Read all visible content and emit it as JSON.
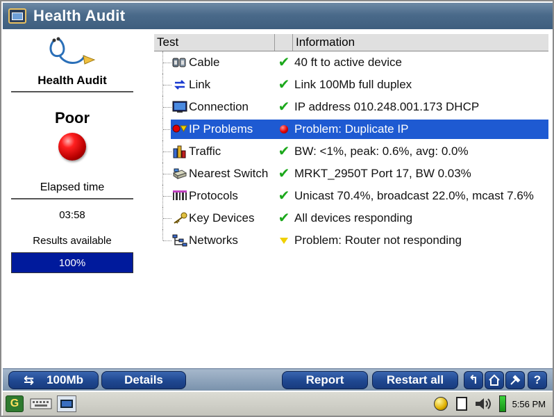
{
  "window": {
    "title": "Health Audit"
  },
  "left_panel": {
    "title": "Health Audit",
    "status": "Poor",
    "elapsed_label": "Elapsed time",
    "elapsed_value": "03:58",
    "results_label": "Results available",
    "progress_percent": 100,
    "progress_text": "100%"
  },
  "table": {
    "columns": [
      "Test",
      "",
      "Information"
    ],
    "rows": [
      {
        "test": "Cable",
        "icon": "cable-icon",
        "status": "ok",
        "info": "40 ft to active device"
      },
      {
        "test": "Link",
        "icon": "link-arrows-icon",
        "status": "ok",
        "info": "Link 100Mb full duplex"
      },
      {
        "test": "Connection",
        "icon": "monitor-icon",
        "status": "ok",
        "info": "IP address 010.248.001.173 DHCP"
      },
      {
        "test": "IP Problems",
        "icon": "ip-problems-icon",
        "status": "error",
        "info": "Problem: Duplicate IP"
      },
      {
        "test": "Traffic",
        "icon": "traffic-icon",
        "status": "ok",
        "info": "BW: <1%, peak: 0.6%, avg: 0.0%"
      },
      {
        "test": "Nearest Switch",
        "icon": "switch-icon",
        "status": "ok",
        "info": "MRKT_2950T Port 17, BW 0.03%"
      },
      {
        "test": "Protocols",
        "icon": "protocols-icon",
        "status": "ok",
        "info": "Unicast 70.4%, broadcast 22.0%, mcast 7.6%"
      },
      {
        "test": "Key Devices",
        "icon": "key-icon",
        "status": "ok",
        "info": "All devices responding"
      },
      {
        "test": "Networks",
        "icon": "networks-icon",
        "status": "warning",
        "info": "Problem: Router not responding"
      }
    ],
    "selected_index": 3
  },
  "toolbar": {
    "speed_label": "100Mb",
    "details_label": "Details",
    "report_label": "Report",
    "restart_label": "Restart all",
    "help_label": "?"
  },
  "taskbar": {
    "clock": "5:56 PM"
  },
  "colors": {
    "selection": "#1e5ad2",
    "progress_fill": "#001a9c",
    "ok": "#1ca81c",
    "error": "#e00000",
    "warning": "#f0d000"
  }
}
